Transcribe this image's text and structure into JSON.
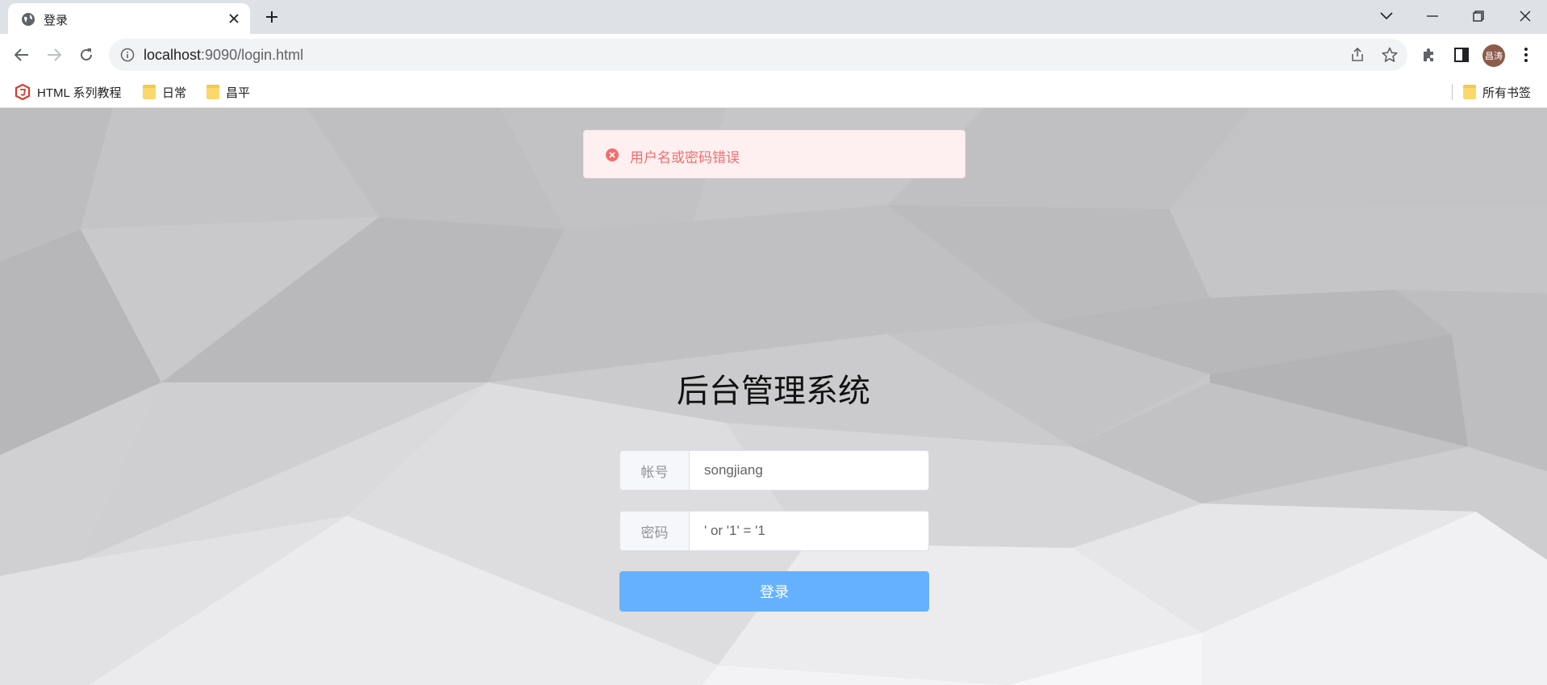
{
  "browser": {
    "tab": {
      "title": "登录"
    },
    "url": {
      "host": "localhost",
      "rest": ":9090/login.html"
    },
    "profile_initials": "昌涛",
    "bookmarks": [
      {
        "label": "HTML 系列教程",
        "icon": "html-logo-icon"
      },
      {
        "label": "日常",
        "icon": "folder-icon"
      },
      {
        "label": "昌平",
        "icon": "folder-icon"
      }
    ],
    "all_bookmarks_label": "所有书签"
  },
  "page": {
    "alert": {
      "message": "用户名或密码错误",
      "type": "error",
      "color": "#f56c6c"
    },
    "title": "后台管理系统",
    "username": {
      "prepend": "帐号",
      "value": "songjiang"
    },
    "password": {
      "prepend": "密码",
      "value": "' or '1' = '1"
    },
    "submit_label": "登录",
    "accent_color": "#66b1ff"
  }
}
